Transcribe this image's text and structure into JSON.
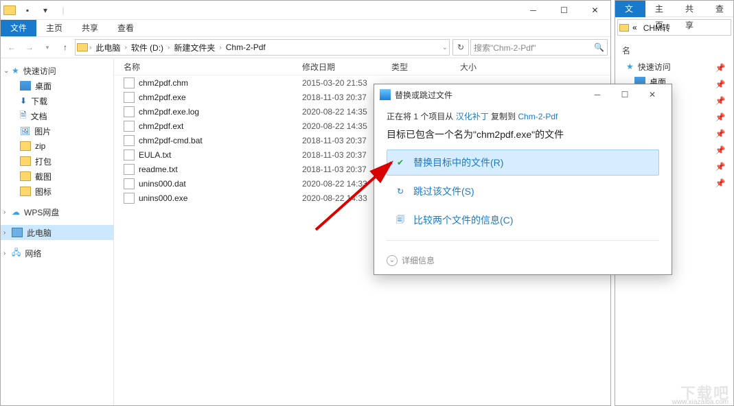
{
  "window": {
    "tabs": {
      "file": "文件",
      "home": "主页",
      "share": "共享",
      "view": "查看"
    },
    "breadcrumbs": [
      "此电脑",
      "软件 (D:)",
      "新建文件夹",
      "Chm-2-Pdf"
    ],
    "search_placeholder": "搜索\"Chm-2-Pdf\"",
    "columns": {
      "name": "名称",
      "date": "修改日期",
      "type": "类型",
      "size": "大小"
    },
    "files": [
      {
        "name": "chm2pdf.chm",
        "date": "2015-03-20 21:53"
      },
      {
        "name": "chm2pdf.exe",
        "date": "2018-11-03 20:37"
      },
      {
        "name": "chm2pdf.exe.log",
        "date": "2020-08-22 14:35"
      },
      {
        "name": "chm2pdf.ext",
        "date": "2020-08-22 14:35"
      },
      {
        "name": "chm2pdf-cmd.bat",
        "date": "2018-11-03 20:37"
      },
      {
        "name": "EULA.txt",
        "date": "2018-11-03 20:37"
      },
      {
        "name": "readme.txt",
        "date": "2018-11-03 20:37"
      },
      {
        "name": "unins000.dat",
        "date": "2020-08-22 14:33"
      },
      {
        "name": "unins000.exe",
        "date": "2020-08-22 14:33"
      }
    ]
  },
  "sidebar": {
    "quick": "快速访问",
    "items": [
      "桌面",
      "下载",
      "文档",
      "图片",
      "zip",
      "打包",
      "截图",
      "图标"
    ],
    "wps": "WPS网盘",
    "thispc": "此电脑",
    "network": "网络"
  },
  "window2": {
    "tabs": {
      "file": "文件",
      "home": "主页",
      "share": "共享",
      "view": "查"
    },
    "crumb": "CHM转",
    "quick": "快速访问",
    "desktop": "桌面",
    "name_col": "名"
  },
  "dialog": {
    "title": "替换或跳过文件",
    "line_prefix": "正在将 1 个项目从 ",
    "line_link1": "汉化补丁",
    "line_mid": " 复制到 ",
    "line_link2": "Chm-2-Pdf",
    "heading": "目标已包含一个名为\"chm2pdf.exe\"的文件",
    "opt_replace": "替换目标中的文件(R)",
    "opt_skip": "跳过该文件(S)",
    "opt_compare": "比较两个文件的信息(C)",
    "more": "详细信息"
  },
  "watermark": "下载吧",
  "watermark_url": "www.xiazaiba.com"
}
